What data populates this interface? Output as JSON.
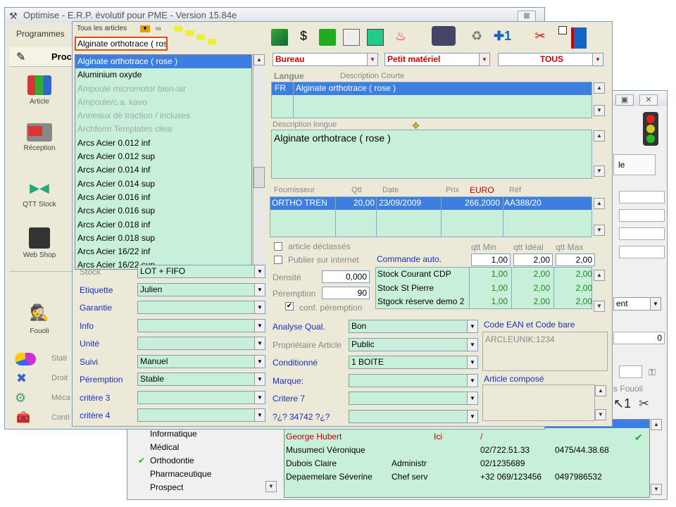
{
  "main_window": {
    "title": "Optimise - E.R.P. évolutif pour PME - Version 15.84e",
    "menu_programmes": "Programmes",
    "close_btn": "⊠"
  },
  "sidebar": {
    "header": "Proc",
    "items": [
      {
        "label": "Article"
      },
      {
        "label": "Réception"
      },
      {
        "label": "QTT Stock"
      },
      {
        "label": "Web Shop"
      },
      {
        "label": "Fouoli"
      }
    ],
    "bottom": [
      "Stati",
      "Droit",
      "Méca",
      "Conti"
    ]
  },
  "article_search": {
    "filter_label": "Tous les articles",
    "search_value": "Alginate orthotrace ( rose )"
  },
  "article_list": [
    {
      "label": "Alginate orthotrace ( rose )",
      "state": "sel"
    },
    {
      "label": "Aluminium oxyde",
      "state": "n"
    },
    {
      "label": "Ampoule micromotor bien-air",
      "state": "dim"
    },
    {
      "label": "Ampoule/c.a. kavo",
      "state": "dim"
    },
    {
      "label": "Anneaux de traction / incluses",
      "state": "dim"
    },
    {
      "label": "Archform Templates clear",
      "state": "dim"
    },
    {
      "label": "Arcs Acier 0.012 inf",
      "state": "n"
    },
    {
      "label": "Arcs Acier 0.012 sup",
      "state": "n"
    },
    {
      "label": "Arcs Acier 0.014 inf",
      "state": "n"
    },
    {
      "label": "Arcs Acier 0.014 sup",
      "state": "n"
    },
    {
      "label": "Arcs Acier 0.016 inf",
      "state": "n"
    },
    {
      "label": "Arcs Acier 0.016 sup",
      "state": "n"
    },
    {
      "label": "Arcs Acier 0.018 inf",
      "state": "n"
    },
    {
      "label": "Arcs Acier 0.018 sup",
      "state": "n"
    },
    {
      "label": "Arcs Acier 16/22 inf",
      "state": "n"
    },
    {
      "label": "Arcs Acier 16/22 sup",
      "state": "n"
    }
  ],
  "category": {
    "c1": "Bureau",
    "c2": "Petit matériel",
    "c3": "TOUS"
  },
  "langue": {
    "header_langue": "Langue",
    "header_desc": "Description Courte",
    "code": "FR",
    "desc": "Alginate orthotrace ( rose )"
  },
  "desc_longue": {
    "label": "Description longue",
    "value": "Alginate orthotrace ( rose )"
  },
  "supplier": {
    "headers": [
      "Fournisseur",
      "Qtt",
      "Date",
      "Prix",
      "EURO",
      "Réf"
    ],
    "row": [
      "ORTHO TREN",
      "20,00",
      "23/09/2009",
      "266,2000",
      "AA388/20"
    ]
  },
  "left_props": [
    {
      "label": "Stock",
      "value": "LOT + FIFO",
      "style": "gray"
    },
    {
      "label": "Etiquette",
      "value": "Julien",
      "style": "blue"
    },
    {
      "label": "Garantie",
      "value": "",
      "style": "blue"
    },
    {
      "label": "Info",
      "value": "",
      "style": "blue"
    },
    {
      "label": "Unité",
      "value": "",
      "style": "blue"
    },
    {
      "label": "Suivi",
      "value": "Manuel",
      "style": "blue"
    },
    {
      "label": "Péremption",
      "value": "Stable",
      "style": "blue"
    },
    {
      "label": "critère 3",
      "value": "",
      "style": "blue"
    },
    {
      "label": "critère 4",
      "value": "",
      "style": "blue"
    }
  ],
  "checks": {
    "declasse": "article déclassés",
    "internet": "Publier sur internet",
    "commande": "Commande auto.",
    "densite": "Densité",
    "densite_val": "0,000",
    "peremption": "Péremption",
    "peremption_val": "90",
    "conf": "conf. péremption"
  },
  "stock": {
    "headers": [
      "qtt Min",
      "qtt Idéal",
      "qtt Max"
    ],
    "defaults": [
      "1,00",
      "2,00",
      "2,00"
    ],
    "rows": [
      {
        "name": "Stock Courant CDP",
        "v": [
          "1,00",
          "2,00",
          "2,00"
        ]
      },
      {
        "name": "Stock St Pierre",
        "v": [
          "1,00",
          "2,00",
          "2,00"
        ]
      },
      {
        "name": "Stgock réserve demo 2",
        "v": [
          "1,00",
          "2,00",
          "2,00"
        ]
      }
    ]
  },
  "mid_props": [
    {
      "label": "Analyse Qual.",
      "value": "Bon",
      "style": "blue"
    },
    {
      "label": "Propriétaire Article",
      "value": "Public",
      "style": "gray"
    },
    {
      "label": "Conditionné",
      "value": "1 BOITE",
      "style": "blue"
    },
    {
      "label": "Marque:",
      "value": "",
      "style": "blue"
    },
    {
      "label": "Critere 7",
      "value": "",
      "style": "blue"
    },
    {
      "label": "?¿? 34742 ?¿?",
      "value": "",
      "style": "blue"
    }
  ],
  "ean": {
    "label": "Code EAN et Code bare",
    "value": "ARCLEUNIK:1234"
  },
  "compose": {
    "label": "Article composé"
  },
  "back_window": {
    "tab": "le",
    "combo": "ent",
    "zero": "0",
    "fouoli": "s Fouoli",
    "sectors": [
      "Informatique",
      "Médical",
      "Orthodontie",
      "Pharmaceutique",
      "Prospect"
    ],
    "contacts": [
      {
        "name": "George Hubert",
        "role": "",
        "loc": "Ici",
        "tel": "/",
        "gsm": ""
      },
      {
        "name": "Musumeci Véronique",
        "role": "",
        "loc": "",
        "tel": "02/722.51.33",
        "gsm": "0475/44.38.68"
      },
      {
        "name": "Dubois Claire",
        "role": "Administr",
        "loc": "",
        "tel": "02/1235689",
        "gsm": ""
      },
      {
        "name": "Depaemelare Séverine",
        "role": "Chef serv",
        "loc": "",
        "tel": "+32 069/123456",
        "gsm": "0497986532"
      }
    ]
  }
}
